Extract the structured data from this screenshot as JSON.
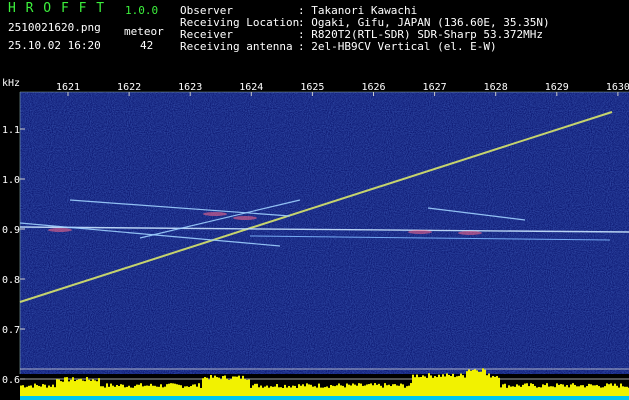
{
  "app": {
    "title": "H R O F F T",
    "version": "1.0.0",
    "filename": "2510021620.png",
    "timestamp": "25.10.02 16:20",
    "meteor_label": "meteor",
    "meteor_count": "42"
  },
  "info": {
    "observer_label": "Observer",
    "observer_value": ": Takanori Kawachi",
    "location_label": "Receiving Location",
    "location_value": ": Ogaki, Gifu, JAPAN (136.60E, 35.35N)",
    "receiver_label": "Receiver",
    "receiver_value": ": R820T2(RTL-SDR) SDR-Sharp 53.372MHz",
    "antenna_label": "Receiving antenna",
    "antenna_value": ": 2el-HB9CV Vertical (el. E-W)"
  },
  "axes": {
    "y_unit": "kHz",
    "x_ticks": [
      "1621",
      "1622",
      "1623",
      "1624",
      "1625",
      "1626",
      "1627",
      "1628",
      "1629",
      "1630"
    ],
    "y_ticks": [
      "1.1",
      "1.0",
      "0.9",
      "0.8",
      "0.7",
      "0.6"
    ]
  },
  "colors": {
    "background": "#000000",
    "waterfall": "#0b1670",
    "trace": "#d8e66a",
    "header_green": "#3cf03c",
    "signal_bar": "#f2f200",
    "signal_base": "#00c8f0"
  }
}
